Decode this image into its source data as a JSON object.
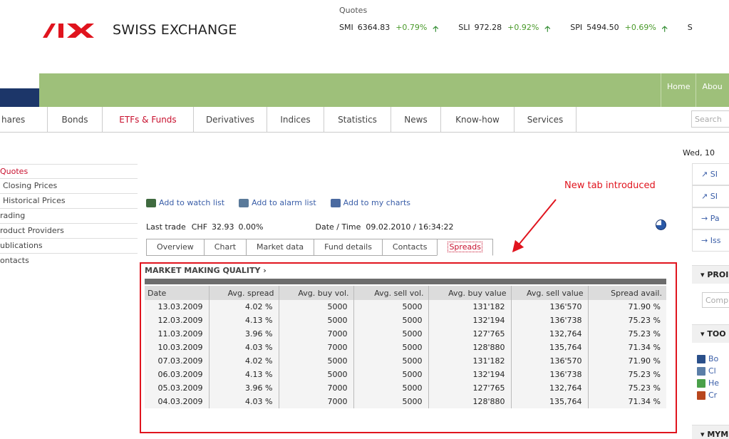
{
  "header": {
    "logo_text": "SWISS EXCHANGE",
    "quotes_label": "Quotes",
    "quotes": [
      {
        "symbol": "SMI",
        "value": "6364.83",
        "change": "+0.79%"
      },
      {
        "symbol": "SLI",
        "value": "972.28",
        "change": "+0.92%"
      },
      {
        "symbol": "SPI",
        "value": "5494.50",
        "change": "+0.69%"
      },
      {
        "symbol": "S",
        "value": "",
        "change": ""
      }
    ],
    "top_links": [
      "Home",
      "Abou"
    ]
  },
  "nav": {
    "items": [
      "hares",
      "Bonds",
      "ETFs & Funds",
      "Derivatives",
      "Indices",
      "Statistics",
      "News",
      "Know-how",
      "Services"
    ],
    "active": "ETFs & Funds",
    "search_placeholder": "Search"
  },
  "left_menu": [
    "Quotes",
    "Closing Prices",
    "Historical Prices",
    "rading",
    "roduct Providers",
    "ublications",
    "ontacts"
  ],
  "actions": {
    "watch": "Add to watch list",
    "alarm": "Add to alarm list",
    "charts": "Add to my charts"
  },
  "trade": {
    "label": "Last trade",
    "currency": "CHF",
    "price": "32.93",
    "change": "0.00%",
    "datetime_label": "Date / Time",
    "datetime": "09.02.2010 / 16:34:22"
  },
  "annotation": "New tab introduced",
  "tabs": [
    "Overview",
    "Chart",
    "Market data",
    "Fund details",
    "Contacts",
    "Spreads"
  ],
  "active_tab": "Spreads",
  "section_title": "MARKET MAKING QUALITY ›",
  "table": {
    "headers": [
      "Date",
      "Avg. spread",
      "Avg. buy vol.",
      "Avg. sell vol.",
      "Avg. buy value",
      "Avg. sell value",
      "Spread avail."
    ],
    "rows": [
      [
        "13.03.2009",
        "4.02 %",
        "5000",
        "5000",
        "131'182",
        "136'570",
        "71.90 %"
      ],
      [
        "12.03.2009",
        "4.13 %",
        "5000",
        "5000",
        "132'194",
        "136'738",
        "75.23 %"
      ],
      [
        "11.03.2009",
        "3.96 %",
        "7000",
        "5000",
        "127'765",
        "132,764",
        "75.23 %"
      ],
      [
        "10.03.2009",
        "4.03 %",
        "7000",
        "5000",
        "128'880",
        "135,764",
        "71.34 %"
      ],
      [
        "07.03.2009",
        "4.02 %",
        "5000",
        "5000",
        "131'182",
        "136'570",
        "71.90 %"
      ],
      [
        "06.03.2009",
        "4.13 %",
        "5000",
        "5000",
        "132'194",
        "136'738",
        "75.23 %"
      ],
      [
        "05.03.2009",
        "3.96 %",
        "7000",
        "5000",
        "127'765",
        "132,764",
        "75.23 %"
      ],
      [
        "04.03.2009",
        "4.03 %",
        "7000",
        "5000",
        "128'880",
        "135,764",
        "71.34 %"
      ]
    ]
  },
  "right": {
    "date": "Wed, 10",
    "links": [
      "↗ SI",
      "↗ SI",
      "→ Pa",
      "→ Iss"
    ],
    "heads": [
      "▾ PROI",
      "▾ TOO",
      "▾ MYM"
    ],
    "input_placeholder": "Comp",
    "tools": [
      "Bo",
      "Cl",
      "He",
      "Cr"
    ]
  },
  "colors": {
    "accent_red": "#c8102e",
    "nav_green": "#a5c47e",
    "navy": "#1c3669",
    "annotation_red": "#e0141e"
  }
}
